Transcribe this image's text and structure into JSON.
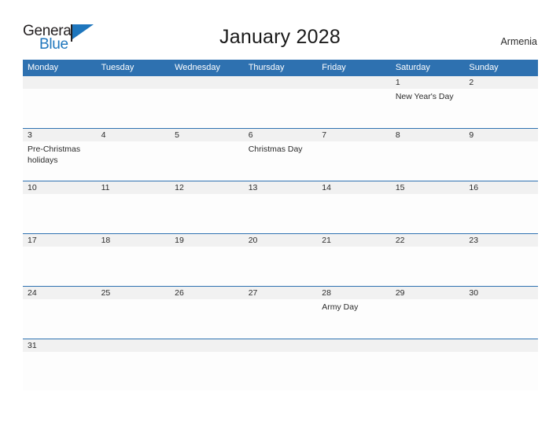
{
  "header": {
    "logo": {
      "word1": "General",
      "word2": "Blue",
      "flag_icon": "blue-flag-triangle"
    },
    "title": "January 2028",
    "country": "Armenia"
  },
  "calendar": {
    "weekdays": [
      "Monday",
      "Tuesday",
      "Wednesday",
      "Thursday",
      "Friday",
      "Saturday",
      "Sunday"
    ],
    "accent_color": "#2e71b0",
    "number_band_color": "#f1f1f1",
    "weeks": [
      {
        "days": [
          {
            "num": "",
            "event": ""
          },
          {
            "num": "",
            "event": ""
          },
          {
            "num": "",
            "event": ""
          },
          {
            "num": "",
            "event": ""
          },
          {
            "num": "",
            "event": ""
          },
          {
            "num": "1",
            "event": "New Year's Day"
          },
          {
            "num": "2",
            "event": ""
          }
        ]
      },
      {
        "days": [
          {
            "num": "3",
            "event": "Pre-Christmas holidays"
          },
          {
            "num": "4",
            "event": ""
          },
          {
            "num": "5",
            "event": ""
          },
          {
            "num": "6",
            "event": "Christmas Day"
          },
          {
            "num": "7",
            "event": ""
          },
          {
            "num": "8",
            "event": ""
          },
          {
            "num": "9",
            "event": ""
          }
        ]
      },
      {
        "days": [
          {
            "num": "10",
            "event": ""
          },
          {
            "num": "11",
            "event": ""
          },
          {
            "num": "12",
            "event": ""
          },
          {
            "num": "13",
            "event": ""
          },
          {
            "num": "14",
            "event": ""
          },
          {
            "num": "15",
            "event": ""
          },
          {
            "num": "16",
            "event": ""
          }
        ]
      },
      {
        "days": [
          {
            "num": "17",
            "event": ""
          },
          {
            "num": "18",
            "event": ""
          },
          {
            "num": "19",
            "event": ""
          },
          {
            "num": "20",
            "event": ""
          },
          {
            "num": "21",
            "event": ""
          },
          {
            "num": "22",
            "event": ""
          },
          {
            "num": "23",
            "event": ""
          }
        ]
      },
      {
        "days": [
          {
            "num": "24",
            "event": ""
          },
          {
            "num": "25",
            "event": ""
          },
          {
            "num": "26",
            "event": ""
          },
          {
            "num": "27",
            "event": ""
          },
          {
            "num": "28",
            "event": "Army Day"
          },
          {
            "num": "29",
            "event": ""
          },
          {
            "num": "30",
            "event": ""
          }
        ]
      },
      {
        "days": [
          {
            "num": "31",
            "event": ""
          },
          {
            "num": "",
            "event": ""
          },
          {
            "num": "",
            "event": ""
          },
          {
            "num": "",
            "event": ""
          },
          {
            "num": "",
            "event": ""
          },
          {
            "num": "",
            "event": ""
          },
          {
            "num": "",
            "event": ""
          }
        ]
      }
    ]
  }
}
